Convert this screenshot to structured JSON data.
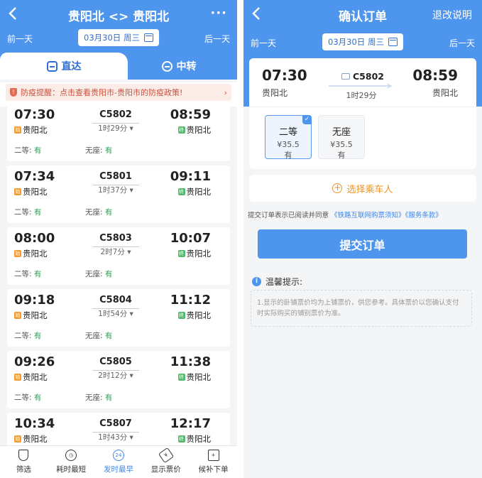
{
  "left": {
    "header": {
      "title": "贵阳北 <> 贵阳北",
      "more": "···"
    },
    "datebar": {
      "prev": "前一天",
      "date": "03月30日 周三",
      "next": "后一天"
    },
    "tabs": [
      {
        "label": "直达"
      },
      {
        "label": "中转"
      }
    ],
    "notice": {
      "text": "防疫提醒：点击查看贵阳市-贵阳市的防疫政策!",
      "arrow": "›",
      "shield": "!"
    },
    "trains": [
      {
        "dep": "07:30",
        "code": "C5802",
        "dur": "1时29分 ▾",
        "arr": "08:59",
        "from": "贵阳北",
        "to": "贵阳北",
        "seat1": "二等: ",
        "seat1v": "有",
        "seat2": "无座: ",
        "seat2v": "有",
        "fb": "始",
        "tb": "终"
      },
      {
        "dep": "07:34",
        "code": "C5801",
        "dur": "1时37分 ▾",
        "arr": "09:11",
        "from": "贵阳北",
        "to": "贵阳北",
        "seat1": "二等: ",
        "seat1v": "有",
        "seat2": "无座: ",
        "seat2v": "有",
        "fb": "始",
        "tb": "终"
      },
      {
        "dep": "08:00",
        "code": "C5803",
        "dur": "2时7分 ▾",
        "arr": "10:07",
        "from": "贵阳北",
        "to": "贵阳北",
        "seat1": "二等: ",
        "seat1v": "有",
        "seat2": "无座: ",
        "seat2v": "有",
        "fb": "始",
        "tb": "终"
      },
      {
        "dep": "09:18",
        "code": "C5804",
        "dur": "1时54分 ▾",
        "arr": "11:12",
        "from": "贵阳北",
        "to": "贵阳北",
        "seat1": "二等: ",
        "seat1v": "有",
        "seat2": "无座: ",
        "seat2v": "有",
        "fb": "始",
        "tb": "终"
      },
      {
        "dep": "09:26",
        "code": "C5805",
        "dur": "2时12分 ▾",
        "arr": "11:38",
        "from": "贵阳北",
        "to": "贵阳北",
        "seat1": "二等: ",
        "seat1v": "有",
        "seat2": "无座: ",
        "seat2v": "有",
        "fb": "始",
        "tb": "终"
      },
      {
        "dep": "10:34",
        "code": "C5807",
        "dur": "1时43分 ▾",
        "arr": "12:17",
        "from": "贵阳北",
        "to": "贵阳北",
        "seat1": "二等: ",
        "seat1v": "有",
        "seat2": "无座: ",
        "seat2v": "有",
        "fb": "始",
        "tb": "终"
      }
    ],
    "toolbar": [
      {
        "label": "筛选",
        "icon": "filter-icon",
        "glyph": ""
      },
      {
        "label": "耗时最短",
        "icon": "clock-icon",
        "glyph": "◷"
      },
      {
        "label": "发时最早",
        "icon": "time-24-icon",
        "glyph": "24"
      },
      {
        "label": "显示票价",
        "icon": "price-tag-icon",
        "glyph": "¥"
      },
      {
        "label": "候补下单",
        "icon": "cart-icon",
        "glyph": "+"
      }
    ]
  },
  "right": {
    "header": {
      "title": "确认订单",
      "explain": "退改说明"
    },
    "datebar": {
      "prev": "前一天",
      "date": "03月30日 周三",
      "next": "后一天"
    },
    "trip": {
      "dep": "07:30",
      "from": "贵阳北",
      "code": "C5802",
      "dur": "1时29分",
      "arr": "08:59",
      "to": "贵阳北"
    },
    "seats": [
      {
        "name": "二等",
        "price": "¥35.5",
        "status": "有",
        "check": "✓"
      },
      {
        "name": "无座",
        "price": "¥35.5",
        "status": "有"
      }
    ],
    "passenger": {
      "label": "选择乘车人",
      "plus": "+"
    },
    "agreement": {
      "prefix": "提交订单表示已阅读并同意",
      "link1": "《铁路互联网购票须知》",
      "link2": "《服务条款》"
    },
    "submit_label": "提交订单",
    "tip": {
      "title": "温馨提示:",
      "icon": "i",
      "text": "1.显示的卧铺票价均为上铺票价，供您参考。具体票价以您确认支付时实际购买的铺别票价为准。"
    }
  },
  "colors": {
    "brand": "#4e95ee",
    "accent_orange": "#ee9426",
    "available_green": "#2a9d51"
  }
}
